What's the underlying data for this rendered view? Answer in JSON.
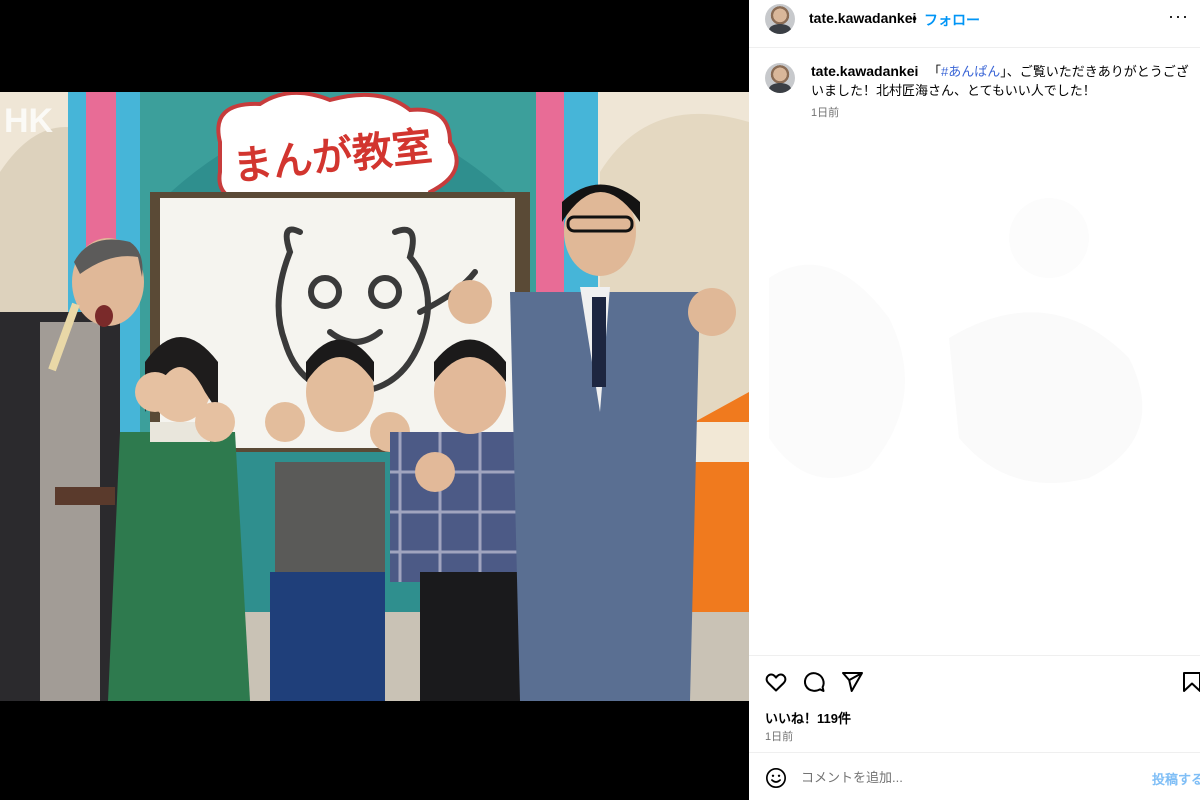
{
  "post": {
    "username": "tate.kawadankei",
    "separator": "•",
    "follow_label": "フォロー",
    "more_label": "···",
    "caption": {
      "quote_open": "「",
      "hashtag": "#あんぱん",
      "text": "」、ご覧いただきありがとうございました！北村匠海さん、とてもいい人でした！"
    },
    "caption_time": "1日前",
    "likes": "いいね！119件",
    "post_time": "1日前"
  },
  "photo": {
    "alt_icons": [
      "heart-icon",
      "comment-icon",
      "share-icon",
      "bookmark-icon"
    ],
    "sign_text": "まんが教室",
    "watermark": "HK"
  },
  "comment_box": {
    "placeholder": "コメントを追加...",
    "post_label": "投稿する",
    "emoji_icon": "smiley-icon"
  },
  "colors": {
    "follow": "#0095f6",
    "hashtag": "#3b66d6",
    "post_button_disabled": "#7fbef6",
    "muted": "#737373"
  }
}
